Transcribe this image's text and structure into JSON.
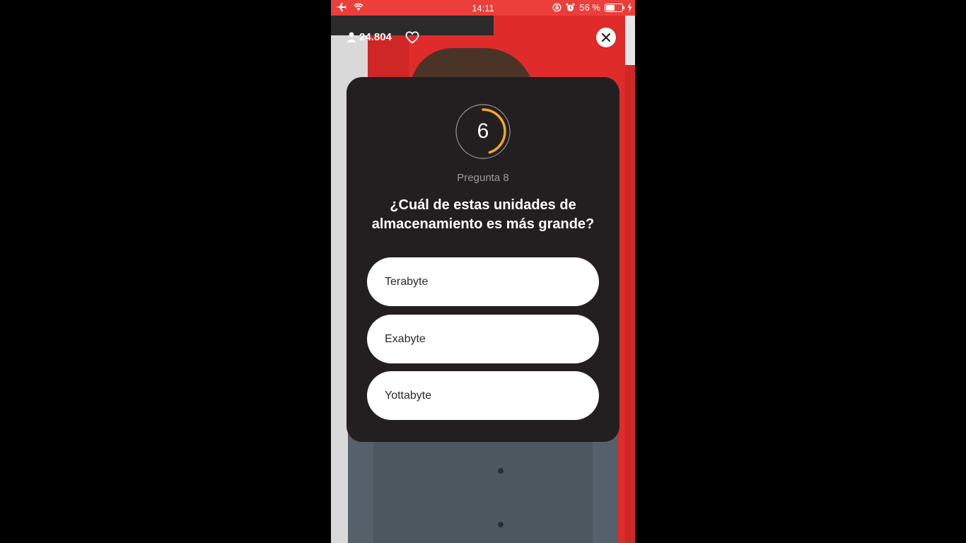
{
  "status_bar": {
    "time": "14:11",
    "battery_percent": "56 %",
    "battery_level": 0.56,
    "icons": [
      "airplane-icon",
      "wifi-icon",
      "rotation-lock-icon",
      "alarm-icon",
      "battery-icon",
      "charging-icon"
    ]
  },
  "overlay": {
    "viewers": "24.804",
    "icons": [
      "person-icon",
      "heart-icon",
      "close-icon"
    ]
  },
  "quiz": {
    "timer_value": "6",
    "timer_progress": 0.45,
    "question_label": "Pregunta 8",
    "question_line1": "¿Cuál de estas unidades de",
    "question_line2": "almacenamiento es más grande?",
    "options": [
      {
        "label": "Terabyte"
      },
      {
        "label": "Exabyte"
      },
      {
        "label": "Yottabyte"
      }
    ]
  },
  "colors": {
    "status_bar": "#ec3e3a",
    "card_bg": "#231f20",
    "timer_accent": "#f5a623",
    "option_bg": "#ffffff"
  }
}
